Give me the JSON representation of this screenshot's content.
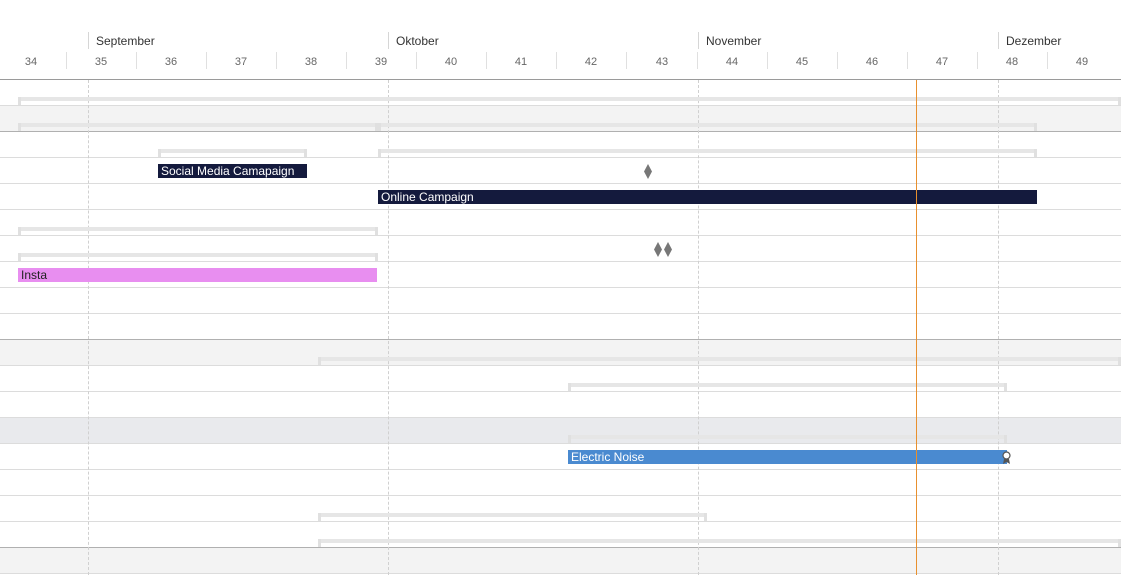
{
  "timeline": {
    "months": [
      "September",
      "Oktober",
      "November",
      "Dezember"
    ],
    "weeks": [
      "34",
      "35",
      "36",
      "37",
      "38",
      "39",
      "40",
      "41",
      "42",
      "43",
      "44",
      "45",
      "46",
      "47",
      "48",
      "49"
    ]
  },
  "tasks": {
    "social_media": {
      "label": "Social Media Camapaign",
      "color": "#141a3d"
    },
    "online_campaign": {
      "label": "Online Campaign",
      "color": "#141a3d"
    },
    "insta": {
      "label": "Insta",
      "color": "#e88ef0"
    },
    "electric_noise": {
      "label": "Electric Noise",
      "color": "#4a8ad0"
    }
  },
  "colors": {
    "today_line": "#e8902e",
    "summary_bar": "#e6e6e6",
    "milestone": "#777777"
  }
}
